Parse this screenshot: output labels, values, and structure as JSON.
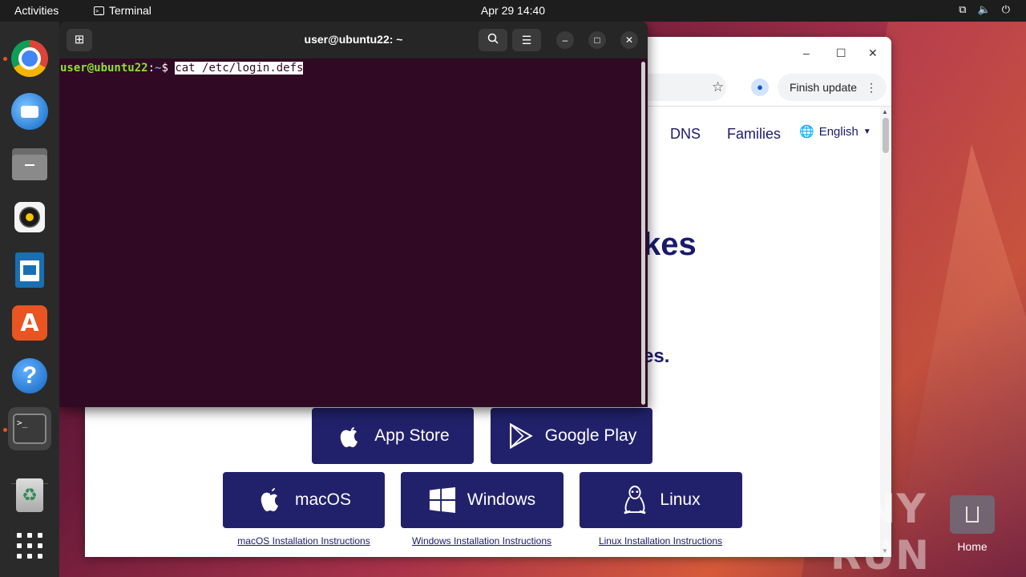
{
  "topbar": {
    "activities": "Activities",
    "app_name": "Terminal",
    "clock": "Apr 29  14:40"
  },
  "dock": {
    "items": [
      "chrome",
      "thunderbird",
      "files",
      "rhythmbox",
      "libreoffice-writer",
      "app-center",
      "help",
      "terminal",
      "trash",
      "show-apps"
    ]
  },
  "terminal": {
    "title": "user@ubuntu22: ~",
    "prompt_user": "user@ubuntu22",
    "prompt_path": ":~",
    "prompt_symbol": "$ ",
    "command": "cat /etc/login.defs"
  },
  "browser": {
    "minimize": "–",
    "maximize": "☐",
    "close": "✕",
    "update_button": "Finish update",
    "nav": {
      "dns": "DNS",
      "families": "Families",
      "language": "English"
    },
    "hero_partial_1": "kes",
    "hero_partial_2": "es.",
    "store_buttons": {
      "app_store": "App Store",
      "google_play": "Google Play"
    },
    "platform_buttons": {
      "macos": "macOS",
      "windows": "Windows",
      "linux": "Linux"
    },
    "install_links": {
      "macos": "macOS Installation Instructions",
      "windows": "Windows Installation Instructions",
      "linux": "Linux Installation Instructions"
    }
  },
  "desktop": {
    "home_label": "Home",
    "watermark": "ANY RUN"
  },
  "colors": {
    "terminal_bg": "#300a24",
    "accent_orange": "#e95420",
    "button_navy": "#21216b"
  }
}
